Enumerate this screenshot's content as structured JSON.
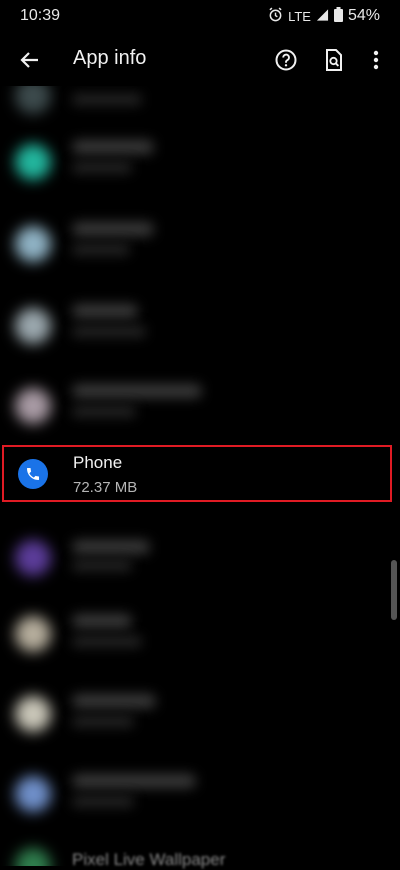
{
  "status": {
    "time": "10:39",
    "network": "LTE",
    "battery": "54%"
  },
  "appbar": {
    "title": "App info"
  },
  "highlighted_app": {
    "name": "Phone",
    "size": "72.37 MB",
    "accent": "#1a73e8"
  },
  "partial_item": {
    "label": "Pixel Live Wallpaper"
  },
  "colors": {
    "highlight_border": "#e01b24",
    "background": "#000000"
  }
}
